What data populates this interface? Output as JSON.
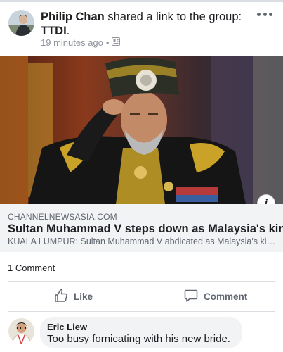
{
  "post": {
    "author": "Philip Chan",
    "action": " shared a link to the group: ",
    "group": "TTDI",
    "group_suffix": ".",
    "timestamp": "19 minutes ago",
    "dot": "•"
  },
  "link": {
    "domain": "CHANNELNEWSASIA.COM",
    "title": "Sultan Muhammad V steps down as Malaysia's king",
    "description": "KUALA LUMPUR: Sultan Muhammad V abdicated as Malaysia's king...",
    "info_glyph": "i"
  },
  "engagement": {
    "comment_count": "1 Comment"
  },
  "actions": {
    "like_label": "Like",
    "comment_label": "Comment"
  },
  "comment": {
    "author": "Eric Liew",
    "text": "Too busy fornicating with his new bride."
  },
  "colors": {
    "text_primary": "#1c1e21",
    "text_secondary": "#606770",
    "meta": "#90949c",
    "card_bg": "#f2f3f5",
    "divider": "#dadde1"
  },
  "icons": [
    "more-horizontal-icon",
    "group-privacy-icon",
    "info-icon",
    "thumbs-up-icon",
    "comment-bubble-icon"
  ]
}
